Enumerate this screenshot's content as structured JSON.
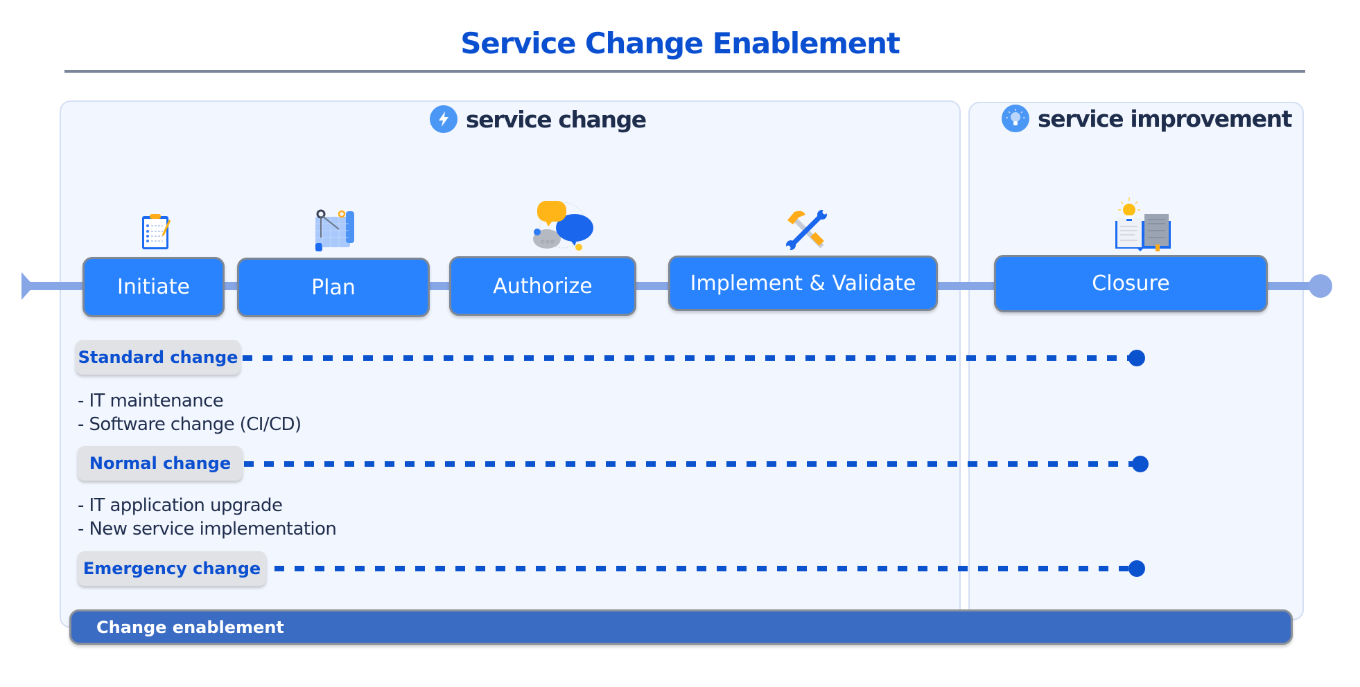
{
  "title": "Service Change Enablement",
  "sections": {
    "change": {
      "label": "service change",
      "icon": "lightning-icon"
    },
    "improvement": {
      "label": "service improvement",
      "icon": "lightbulb-icon"
    }
  },
  "stages": [
    {
      "label": "Initiate",
      "icon": "clipboard-checklist-icon"
    },
    {
      "label": "Plan",
      "icon": "blueprint-compass-icon"
    },
    {
      "label": "Authorize",
      "icon": "chat-bubbles-icon"
    },
    {
      "label": "Implement & Validate",
      "icon": "hammer-wrench-icon"
    },
    {
      "label": "Closure",
      "icon": "book-lightbulb-icon"
    }
  ],
  "change_types": [
    {
      "label": "Standard change",
      "examples": [
        "- IT maintenance",
        "- Software change (CI/CD)"
      ]
    },
    {
      "label": "Normal change",
      "examples": [
        "- IT application upgrade",
        "- New service implementation"
      ]
    },
    {
      "label": "Emergency change",
      "examples": []
    }
  ],
  "footer": {
    "label": "Change enablement"
  },
  "colors": {
    "accent": "#0b4fd1",
    "stage": "#2983ff",
    "timeline": "#86a6e6",
    "footer": "#3a6cc4"
  }
}
